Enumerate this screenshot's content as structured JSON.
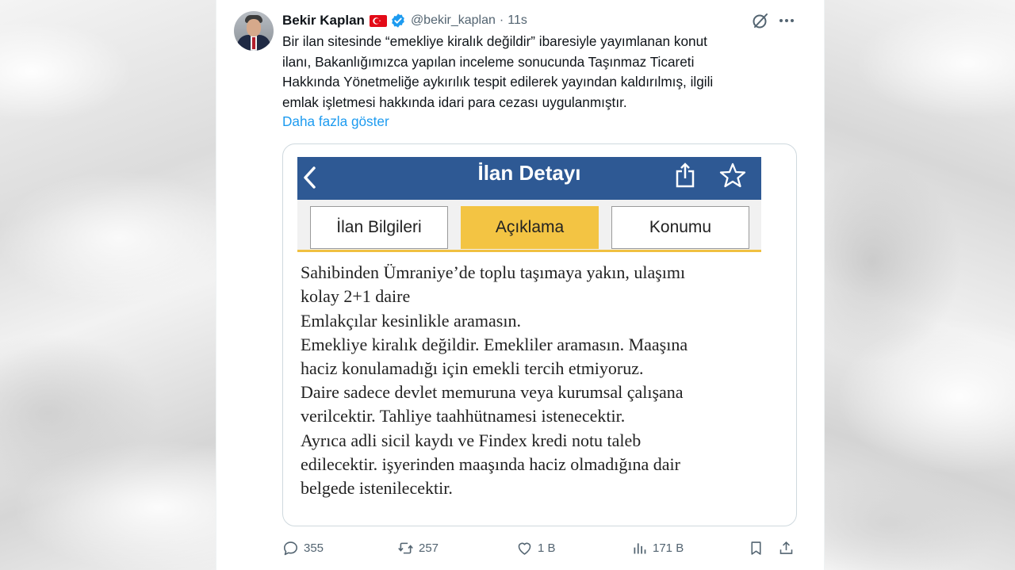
{
  "tweet": {
    "author": {
      "name": "Bekir Kaplan",
      "handle": "@bekir_kaplan",
      "time": "11s",
      "separator": "·",
      "badges": [
        "turkey-flag-icon",
        "verified-badge-icon"
      ]
    },
    "text_lines": [
      "Bir ilan sitesinde “emekliye kiralık değildir” ibaresiyle yayımlanan konut",
      "ilanı, Bakanlığımızca yapılan inceleme sonucunda Taşınmaz Ticareti",
      "Hakkında Yönetmeliğe aykırılık tespit edilerek yayından kaldırılmış, ilgili",
      "emlak işletmesi hakkında idari para cezası uygulanmıştır."
    ],
    "show_more": "Daha fazla göster",
    "colors": {
      "link": "#1d9bf0",
      "text": "#0f1419",
      "muted": "#536471"
    }
  },
  "media": {
    "app_bar": {
      "title": "İlan Detayı",
      "icons": [
        "chevron-left-icon",
        "share-icon",
        "star-icon"
      ],
      "color": "#2e5994"
    },
    "tabs": [
      {
        "label": "İlan Bilgileri",
        "active": false
      },
      {
        "label": "Açıklama",
        "active": true
      },
      {
        "label": "Konumu",
        "active": false
      }
    ],
    "tab_active_color": "#f3c443",
    "description_lines": [
      "Sahibinden Ümraniye’de toplu taşımaya yakın, ulaşımı",
      "kolay 2+1 daire",
      "Emlakçılar kesinlikle aramasın.",
      "Emekliye kiralık değildir. Emekliler aramasın. Maaşına",
      "haciz konulamadığı için emekli tercih etmiyoruz.",
      "Daire sadece devlet memuruna veya kurumsal çalışana",
      "verilcektir. Tahliye taahhütnamesi istenecektir.",
      "Ayrıca adli sicil kaydı ve Findex kredi notu taleb",
      "edilecektir. işyerinden maaşında haciz olmadığına dair",
      "belgede istenilecektir."
    ]
  },
  "actions": {
    "replies": "355",
    "reposts": "257",
    "likes": "1 B",
    "views": "171 B",
    "icons": [
      "reply-icon",
      "repost-icon",
      "like-icon",
      "views-icon",
      "bookmark-icon",
      "share-icon"
    ]
  }
}
